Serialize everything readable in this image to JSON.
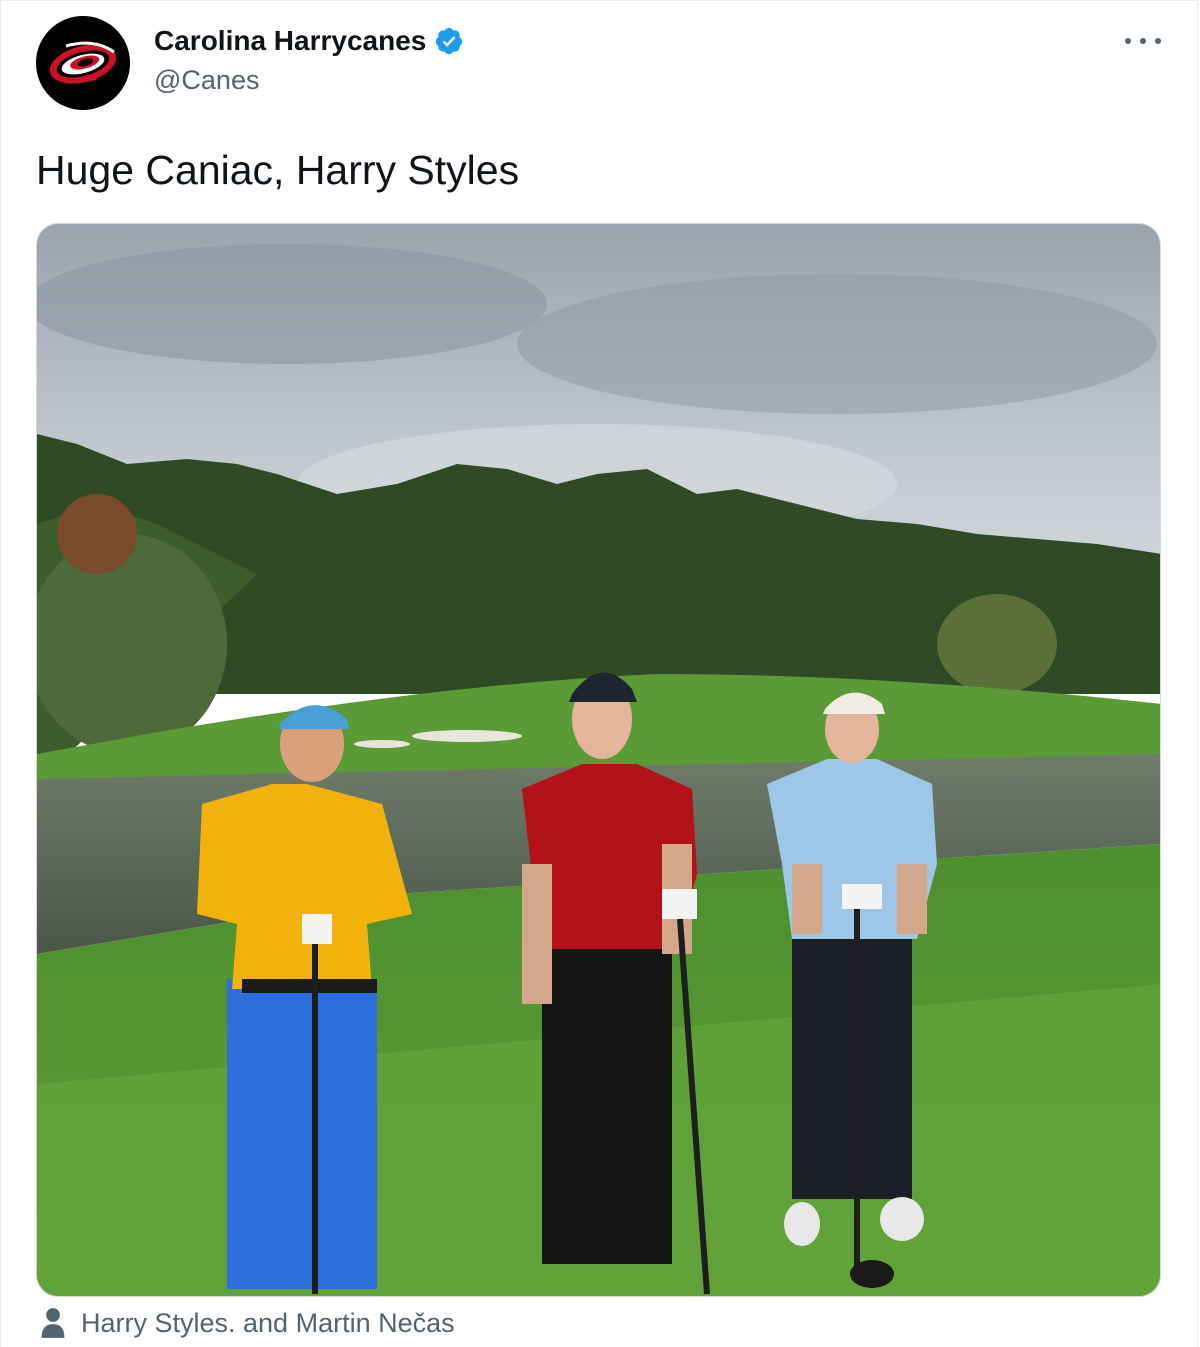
{
  "tweet": {
    "display_name": "Carolina Harrycanes",
    "handle": "@Canes",
    "verified": true,
    "text": "Huge Caniac, Harry Styles",
    "tagged_people": "Harry Styles. and Martin Nečas",
    "avatar_icon": "hurricanes-logo-icon",
    "more_icon": "more-options-icon",
    "tag_icon": "person-tag-icon",
    "colors": {
      "verified_badge": "#1d9bf0",
      "secondary_text": "#536471",
      "logo_red": "#ce1126"
    }
  }
}
